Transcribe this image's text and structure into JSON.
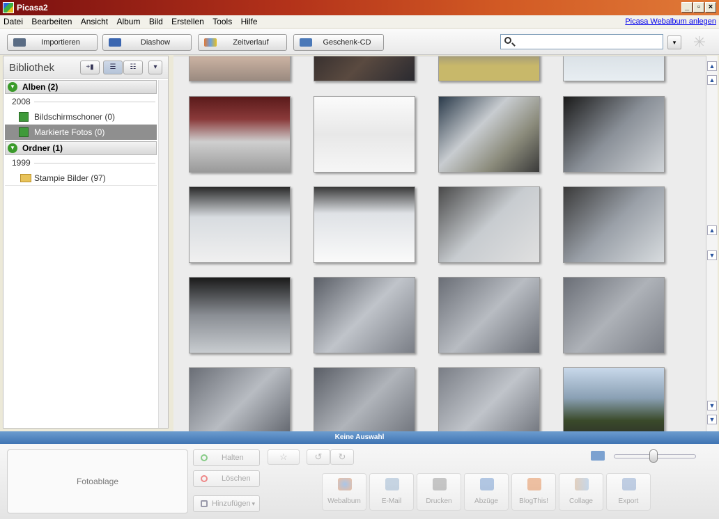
{
  "window": {
    "title": "Picasa2",
    "min": "_",
    "max": "▫",
    "close": "×"
  },
  "menu": [
    "Datei",
    "Bearbeiten",
    "Ansicht",
    "Album",
    "Bild",
    "Erstellen",
    "Tools",
    "Hilfe"
  ],
  "menu_link": "Picasa Webalbum anlegen",
  "toolbar": {
    "import": "Importieren",
    "slideshow": "Diashow",
    "timeline": "Zeitverlauf",
    "giftcd": "Geschenk-CD"
  },
  "search": {
    "placeholder": ""
  },
  "sidebar": {
    "title": "Bibliothek",
    "albums_header": "Alben (2)",
    "album_year": "2008",
    "albums": [
      "Bildschirmschoner (0)",
      "Markierte Fotos (0)"
    ],
    "folders_header": "Ordner (1)",
    "folder_year": "1999",
    "folders": [
      "Stampie Bilder (97)"
    ]
  },
  "status": "Keine Auswahl",
  "tray": {
    "fotoablage": "Fotoablage",
    "hold": "Halten",
    "delete": "Löschen",
    "add": "Hinzufügen"
  },
  "actions": [
    "Webalbum",
    "E-Mail",
    "Drucken",
    "Abzüge",
    "BlogThis!",
    "Collage",
    "Export"
  ],
  "colors": {
    "accent": "#3f74b3",
    "selected": "#8f8f8f",
    "titlebar": "#b3321a"
  }
}
